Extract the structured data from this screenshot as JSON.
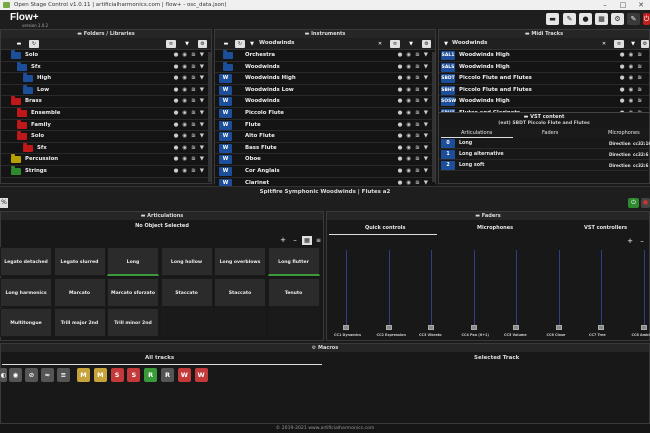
{
  "window": {
    "title": "Open Stage Control v1.0.11 | artificialharmonics.com | flow+ - osc_data.json)",
    "controls": [
      "–",
      "□",
      "✕"
    ]
  },
  "app": {
    "logo": "Flow+",
    "version": "version 1.0.2",
    "toolbar_icons": [
      "folder-icon",
      "brush-icon",
      "globe-icon",
      "grid-icon",
      "gear-icon",
      "wrench-icon",
      "power-icon"
    ]
  },
  "folders_panel": {
    "title": "Folders / Libraries",
    "rows": [
      {
        "label": "Solo",
        "indent": 1,
        "color": "#1d4e9a"
      },
      {
        "label": "Sfx",
        "indent": 2,
        "color": "#1d4e9a"
      },
      {
        "label": "High",
        "indent": 3,
        "color": "#1d4e9a"
      },
      {
        "label": "Low",
        "indent": 3,
        "color": "#1d4e9a"
      },
      {
        "label": "Brass",
        "indent": 1,
        "color": "#c01818"
      },
      {
        "label": "Ensemble",
        "indent": 2,
        "color": "#c01818"
      },
      {
        "label": "Family",
        "indent": 2,
        "color": "#c01818"
      },
      {
        "label": "Solo",
        "indent": 2,
        "color": "#c01818"
      },
      {
        "label": "Sfx",
        "indent": 3,
        "color": "#c01818"
      },
      {
        "label": "Percussion",
        "indent": 1,
        "color": "#b8a000"
      },
      {
        "label": "Strings",
        "indent": 1,
        "color": "#2d8a2d"
      }
    ]
  },
  "instruments_panel": {
    "title": "Instruments",
    "filter_label": "Woodwinds",
    "rows": [
      {
        "label": "Orchestra",
        "folder": true
      },
      {
        "label": "Woodwinds",
        "folder": true
      },
      {
        "label": "Woodwinds High",
        "folder": false
      },
      {
        "label": "Woodwinds Low",
        "folder": false
      },
      {
        "label": "Woodwinds",
        "folder": false
      },
      {
        "label": "Piccolo Flute",
        "folder": false
      },
      {
        "label": "Flute",
        "folder": false
      },
      {
        "label": "Alto Flute",
        "folder": false
      },
      {
        "label": "Bass Flute",
        "folder": false
      },
      {
        "label": "Oboe",
        "folder": false
      },
      {
        "label": "Cor Anglais",
        "folder": false
      },
      {
        "label": "Clarinet",
        "folder": false
      }
    ],
    "w_label": "W"
  },
  "midi_panel": {
    "title": "Midi Tracks",
    "filter_label": "Woodwinds",
    "rows": [
      {
        "code": "SAL1",
        "label": "Woodwinds High"
      },
      {
        "code": "SALS",
        "label": "Woodwinds High"
      },
      {
        "code": "SBDT",
        "label": "Piccolo Flute and Flutes"
      },
      {
        "code": "SBHT",
        "label": "Piccolo Flute and Flutes"
      },
      {
        "code": "SOSW",
        "label": "Woodwinds High"
      },
      {
        "code": "SBHT",
        "label": "Flutes and Clarinets"
      }
    ]
  },
  "vst_panel": {
    "title": "VST content",
    "subtitle": "(ext) SBDT Piccolo Flute and Flutes",
    "tabs": [
      "Articulations",
      "Faders",
      "Microphones"
    ],
    "rows": [
      {
        "num": "0",
        "label": "Long",
        "dir": "Direction",
        "cc": "cc32:16"
      },
      {
        "num": "1",
        "label": "Long alternative",
        "dir": "Direction",
        "cc": "cc32:6"
      },
      {
        "num": "2",
        "label": "Long soft",
        "dir": "Direction",
        "cc": "cc32:6"
      }
    ]
  },
  "midbar": {
    "title": "Spitfire Symphonic Woodwinds | Flutes a2",
    "zoom": "%"
  },
  "articulations_panel": {
    "title": "Articulations",
    "status": "No Object Selected",
    "cells": [
      {
        "label": "Legato detached",
        "green": false
      },
      {
        "label": "Legato slurred",
        "green": false
      },
      {
        "label": "Long",
        "green": true
      },
      {
        "label": "Long hollow",
        "green": false
      },
      {
        "label": "Long overblows",
        "green": false
      },
      {
        "label": "Long flutter",
        "green": true
      },
      {
        "label": "Long harmonics",
        "green": false
      },
      {
        "label": "Marcato",
        "green": false
      },
      {
        "label": "Marcato sforzato",
        "green": false
      },
      {
        "label": "Staccato",
        "green": false
      },
      {
        "label": "Staccato overblows",
        "green": false
      },
      {
        "label": "Tenuto",
        "green": false
      },
      {
        "label": "Multitongue",
        "green": false
      },
      {
        "label": "Trill major 2nd",
        "green": false
      },
      {
        "label": "Trill minor 2nd",
        "green": false
      }
    ]
  },
  "faders_panel": {
    "title": "Faders",
    "tabs": [
      "Quick controls",
      "Microphones",
      "VST controllers"
    ],
    "faders": [
      {
        "label": "CC1 Dynamics",
        "level": 0.0
      },
      {
        "label": "CC2 Expression",
        "level": 0.0
      },
      {
        "label": "CC3 Vibrato",
        "level": 0.0
      },
      {
        "label": "CC4 Pan (0+1)",
        "level": 0.0
      },
      {
        "label": "CC5 Volume",
        "level": 0.0
      },
      {
        "label": "CC6 Close",
        "level": 0.0
      },
      {
        "label": "CC7 Tree",
        "level": 0.0
      },
      {
        "label": "CC8 Ambient",
        "level": 0.0
      }
    ]
  },
  "macros_panel": {
    "title": "Macros",
    "tabs": [
      "All tracks",
      "Selected Track"
    ],
    "buttons": [
      {
        "label": "M",
        "color": "#c8a23a"
      },
      {
        "label": "M",
        "color": "#c8a23a"
      },
      {
        "label": "S",
        "color": "#c43a3a"
      },
      {
        "label": "S",
        "color": "#c43a3a"
      },
      {
        "label": "R",
        "color": "#3a9a3a"
      },
      {
        "label": "R",
        "color": "#555555"
      },
      {
        "label": "W",
        "color": "#c43a3a"
      },
      {
        "label": "W",
        "color": "#c43a3a"
      }
    ]
  },
  "footer": "© 2019-2021 www.artificialharmonics.com"
}
